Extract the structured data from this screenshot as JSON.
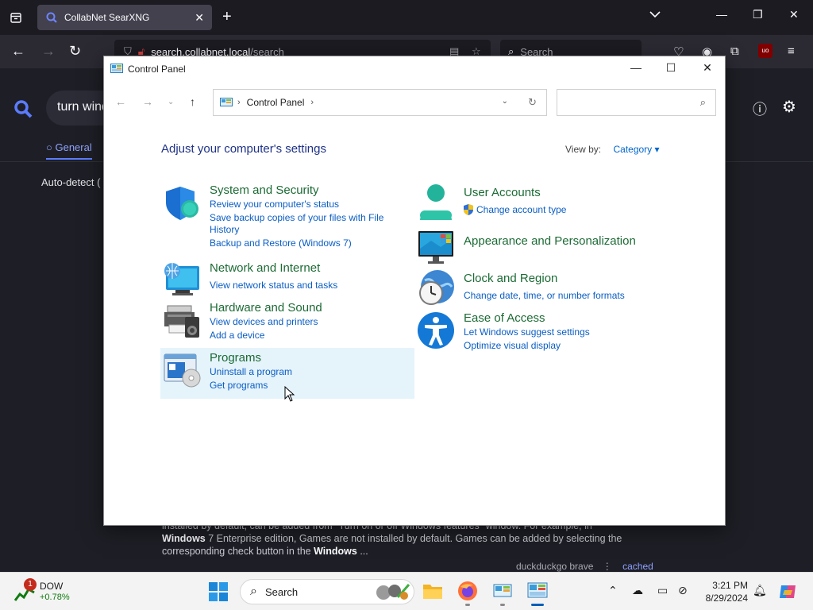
{
  "browser": {
    "tab_title": "CollabNet SearXNG",
    "url_host": "search.collabnet.local",
    "url_path": "/search",
    "search_placeholder": "Search"
  },
  "webpage": {
    "query_text": "turn wind",
    "tab_general": "General",
    "auto_detect": "Auto-detect (",
    "result_line1": "installed by default, can be added from \"Turn on or off Windows features\" window. For example, in",
    "result_line2_b": "Windows",
    "result_line2": " 7 Enterprise edition, Games are not installed by default. Games can be added by selecting the",
    "result_line3": "corresponding check button in the ",
    "result_line3_b": "Windows",
    "result_line3_end": " ...",
    "engines": "duckduckgo  brave",
    "cached": "cached"
  },
  "control_panel": {
    "title": "Control Panel",
    "breadcrumb": "Control Panel",
    "heading": "Adjust your computer's settings",
    "view_by_label": "View by:",
    "view_by_value": "Category",
    "categories": [
      {
        "title": "System and Security",
        "links": [
          "Review your computer's status",
          "Save backup copies of your files with File",
          "History",
          "Backup and Restore (Windows 7)"
        ]
      },
      {
        "title": "Network and Internet",
        "links": [
          "View network status and tasks"
        ]
      },
      {
        "title": "Hardware and Sound",
        "links": [
          "View devices and printers",
          "Add a device"
        ]
      },
      {
        "title": "Programs",
        "links": [
          "Uninstall a program",
          "Get programs"
        ]
      },
      {
        "title": "User Accounts",
        "links": [
          "Change account type"
        ]
      },
      {
        "title": "Appearance and Personalization",
        "links": []
      },
      {
        "title": "Clock and Region",
        "links": [
          "Change date, time, or number formats"
        ]
      },
      {
        "title": "Ease of Access",
        "links": [
          "Let Windows suggest settings",
          "Optimize visual display"
        ]
      }
    ]
  },
  "taskbar": {
    "widget_badge": "1",
    "widget_name": "DOW",
    "widget_change": "+0.78%",
    "search_label": "Search",
    "time": "3:21 PM",
    "date": "8/29/2024"
  },
  "colors": {
    "category_title": "#1c6b35",
    "link": "#0b5ec4",
    "heading": "#1e3287",
    "programs_highlight": "#e5f3fb"
  }
}
